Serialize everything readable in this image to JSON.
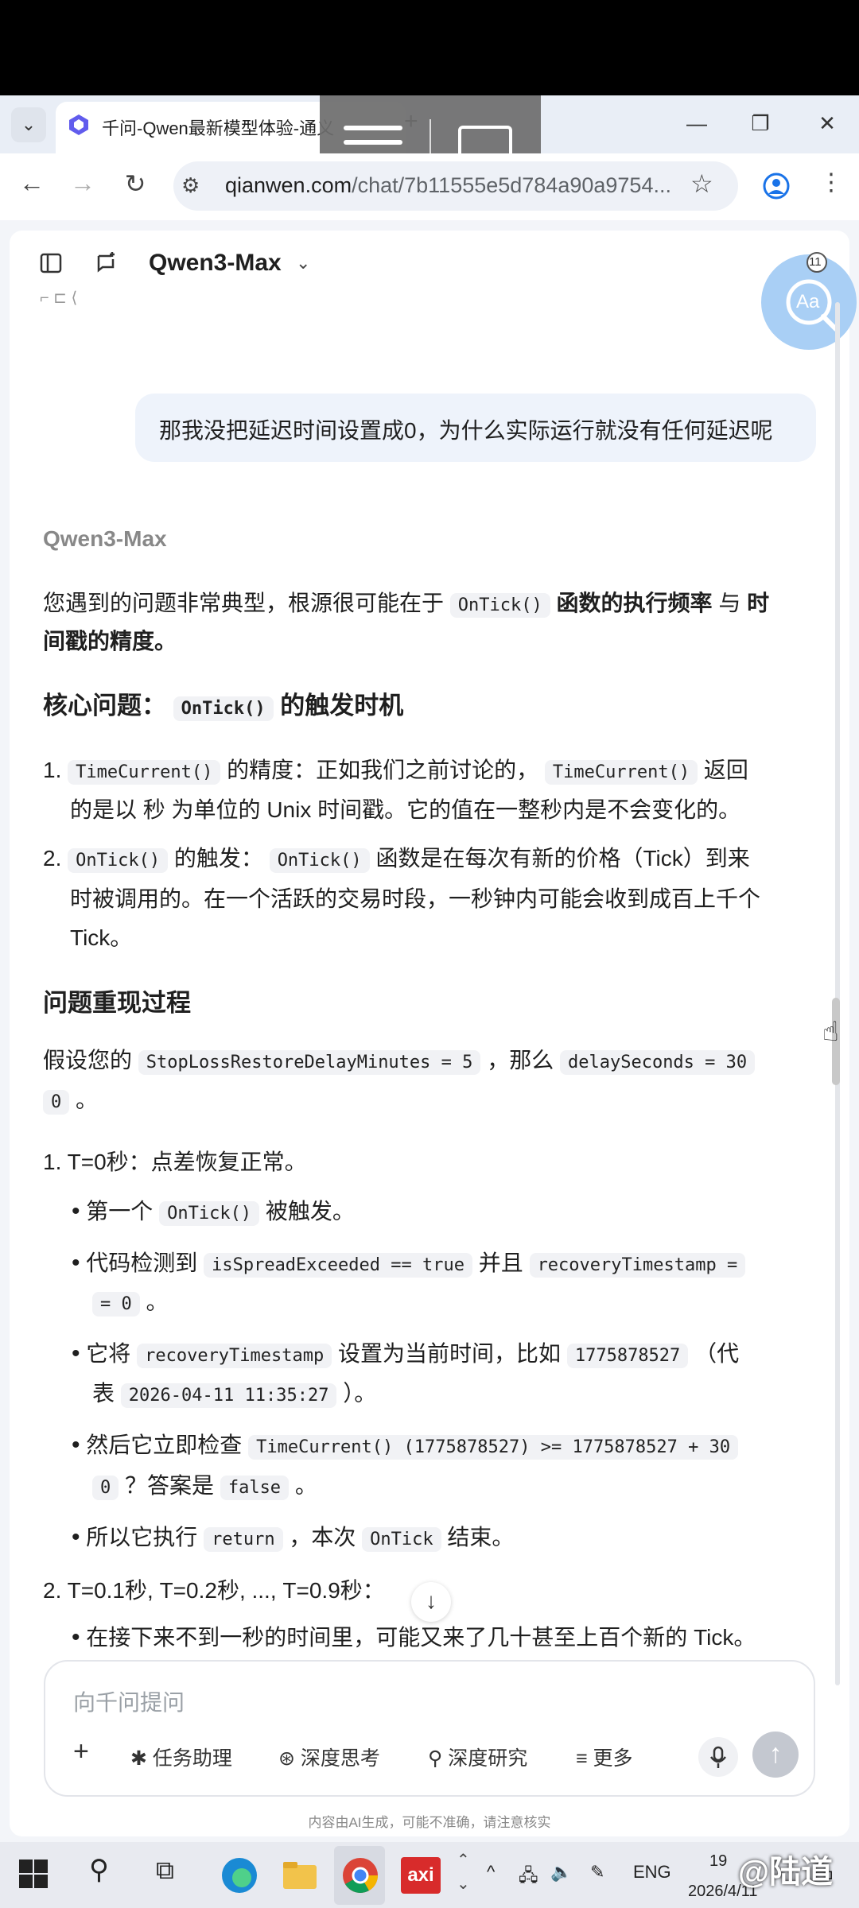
{
  "browser": {
    "tab_title": "千问-Qwen最新模型体验-通义",
    "url_main": "qianwen.com",
    "url_rest": "/chat/7b11555e5d784a90a9754...",
    "new_tab": "+"
  },
  "header": {
    "model_name": "Qwen3-Max",
    "badge_count": "11",
    "badge_label": "Aa"
  },
  "chat": {
    "user_message": "那我没把延迟时间设置成0，为什么实际运行就没有任何延迟呢",
    "ai_name": "Qwen3-Max",
    "intro": {
      "t1": "您遇到的问题非常典型，根源很可能在于",
      "c1": "OnTick()",
      "t2": "函数的执行频率",
      "t3": "与",
      "t4": "时",
      "t5": "间戳的精度。"
    },
    "h_core": {
      "t1": "核心问题：",
      "c1": "OnTick()",
      "t2": "的触发时机"
    },
    "list1": {
      "n1": "1.",
      "c1": "TimeCurrent()",
      "t1": "的精度：正如我们之前讨论的，",
      "c2": "TimeCurrent()",
      "t2": "返回",
      "t3": "的是以 秒 为单位的 Unix 时间戳。它的值在一整秒内是不会变化的。",
      "n2": "2.",
      "c3": "OnTick()",
      "t4": "的触发：",
      "c4": "OnTick()",
      "t5": "函数是在每次有新的价格（Tick）到来",
      "t6": "时被调用的。在一个活跃的交易时段，一秒钟内可能会收到成百上千个",
      "t7": "Tick。"
    },
    "h_repro": "问题重现过程",
    "assume": {
      "t1": "假设您的",
      "c1": "StopLossRestoreDelayMinutes = 5",
      "t2": "，那么",
      "c2": "delaySeconds = 30",
      "c3": "0",
      "t3": "。"
    },
    "step1": {
      "title": "1. T=0秒：点差恢复正常。",
      "b1_t1": "第一个",
      "b1_c1": "OnTick()",
      "b1_t2": "被触发。",
      "b2_t1": "代码检测到",
      "b2_c1": "isSpreadExceeded == true",
      "b2_t2": "并且",
      "b2_c2": "recoveryTimestamp =",
      "b2_c3": "= 0",
      "b2_t3": "。",
      "b3_t1": "它将",
      "b3_c1": "recoveryTimestamp",
      "b3_t2": "设置为当前时间，比如",
      "b3_c2": "1775878527",
      "b3_t3": "（代",
      "b3_t4": "表",
      "b3_c3": "2026-04-11 11:35:27",
      "b3_t5": "）。",
      "b4_t1": "然后它立即检查",
      "b4_c1": "TimeCurrent() (1775878527) >= 1775878527 + 30",
      "b4_c2": "0",
      "b4_t2": "？答案是",
      "b4_c3": "false",
      "b4_t3": "。",
      "b5_t1": "所以它执行",
      "b5_c1": "return",
      "b5_t2": "，本次",
      "b5_c2": "OnTick",
      "b5_t3": "结束。"
    },
    "step2": {
      "title": "2. T=0.1秒, T=0.2秒, ..., T=0.9秒：",
      "b1": "在接下来不到一秒的时间里，可能又来了几十甚至上百个新的 Tick。"
    }
  },
  "composer": {
    "placeholder": "向千问提问",
    "tools": [
      "任务助理",
      "深度思考",
      "深度研究",
      "更多"
    ],
    "disclaimer": "内容由AI生成，可能不准确，请注意核实"
  },
  "taskbar": {
    "lang": "ENG",
    "time": "19",
    "date": "2026/4/11",
    "app_label": "axi",
    "watermark": "@陆道"
  }
}
